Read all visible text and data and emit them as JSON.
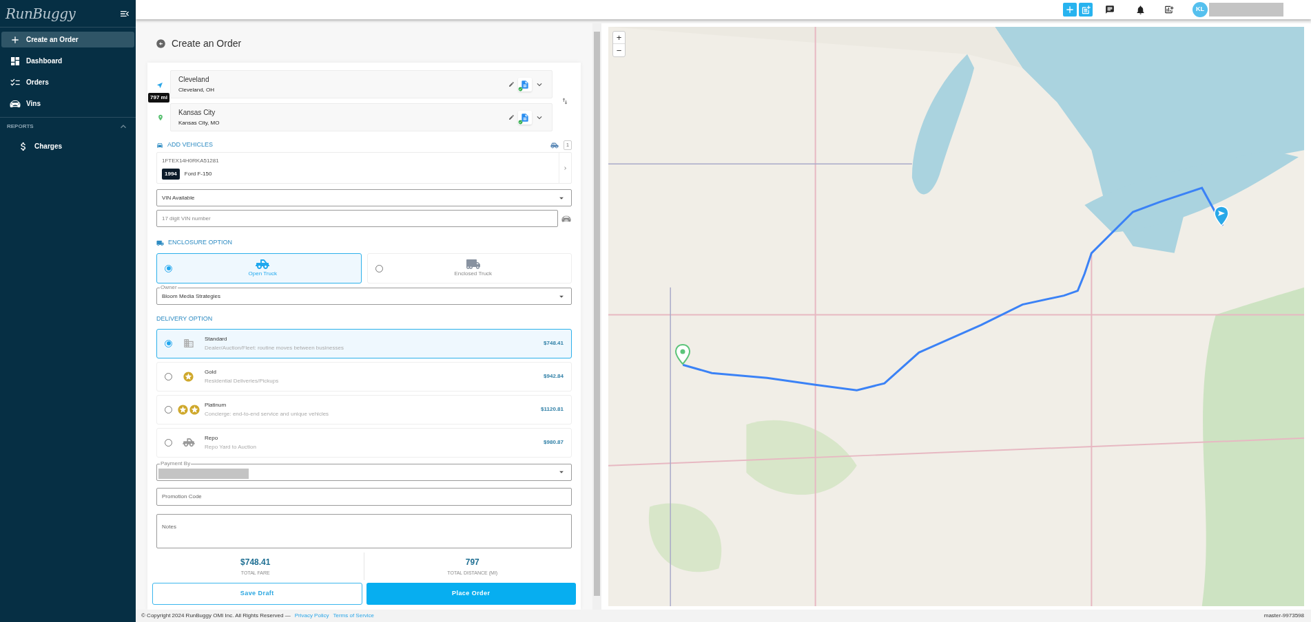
{
  "sidebar": {
    "logo": "RunBuggy",
    "items": [
      {
        "label": "Create an Order",
        "kind": "create",
        "selected": true
      },
      {
        "label": "Dashboard",
        "kind": "dashboard",
        "selected": false
      },
      {
        "label": "Orders",
        "kind": "orders",
        "selected": false
      },
      {
        "label": "Vins",
        "kind": "vins",
        "selected": false
      }
    ],
    "section": {
      "title": "REPORTS",
      "expanded": true,
      "items": [
        {
          "label": "Charges",
          "kind": "charges",
          "selected": false
        }
      ]
    }
  },
  "topbar": {
    "avatar": "KL"
  },
  "form": {
    "title": "Create an Order",
    "stops": [
      {
        "kind": "origin",
        "name": "Cleveland",
        "address": "Cleveland, OH"
      },
      {
        "kind": "destination",
        "name": "Kansas City",
        "address": "Kansas City, MO"
      }
    ],
    "distance_badge": "797 mi",
    "vehicles": {
      "heading": "ADD VEHICLES",
      "count": "1",
      "items": [
        {
          "vin": "1FTEX14H0RKA51281",
          "year": "1994",
          "model": "Ford F-150"
        }
      ]
    },
    "vin_status": {
      "value": "VIN Available"
    },
    "vin_input": {
      "placeholder": "17 digit VIN number"
    },
    "enclosure": {
      "heading": "ENCLOSURE OPTION",
      "options": [
        {
          "kind": "open",
          "label": "Open Truck",
          "selected": true
        },
        {
          "kind": "enclosed",
          "label": "Enclosed Truck",
          "selected": false
        }
      ]
    },
    "owner": {
      "label": "Owner",
      "value": "Bloom Media Strategies"
    },
    "delivery": {
      "heading": "DELIVERY OPTION",
      "options": [
        {
          "kind": "standard",
          "name": "Standard",
          "description": "Dealer/Auction/Fleet: routine moves between businesses",
          "price": "$748.41",
          "selected": true
        },
        {
          "kind": "gold",
          "name": "Gold",
          "description": "Residential Deliveries/Pickups",
          "price": "$942.84",
          "selected": false
        },
        {
          "kind": "platinum",
          "name": "Platinum",
          "description": "Concierge: end-to-end service and unique vehicles",
          "price": "$1120.81",
          "selected": false
        },
        {
          "kind": "repo",
          "name": "Repo",
          "description": "Repo Yard to Auction",
          "price": "$980.87",
          "selected": false
        }
      ]
    },
    "payment": {
      "label": "Payment By"
    },
    "promo": {
      "placeholder": "Promotion Code"
    },
    "notes": {
      "placeholder": "Notes"
    },
    "totals": [
      {
        "value": "$748.41",
        "label": "TOTAL FARE"
      },
      {
        "value": "797",
        "label": "TOTAL DISTANCE (MI)"
      }
    ],
    "buttons": [
      {
        "kind": "secondary",
        "label": "Save Draft"
      },
      {
        "kind": "primary",
        "label": "Place Order"
      }
    ]
  },
  "map": {
    "zoom_in": "+",
    "zoom_out": "−"
  },
  "footer": {
    "copyright": "© Copyright 2024 RunBuggy OMI Inc. All Rights Reserved —",
    "links": [
      "Privacy Policy",
      "Terms of Service"
    ],
    "version": "master-9973598"
  }
}
